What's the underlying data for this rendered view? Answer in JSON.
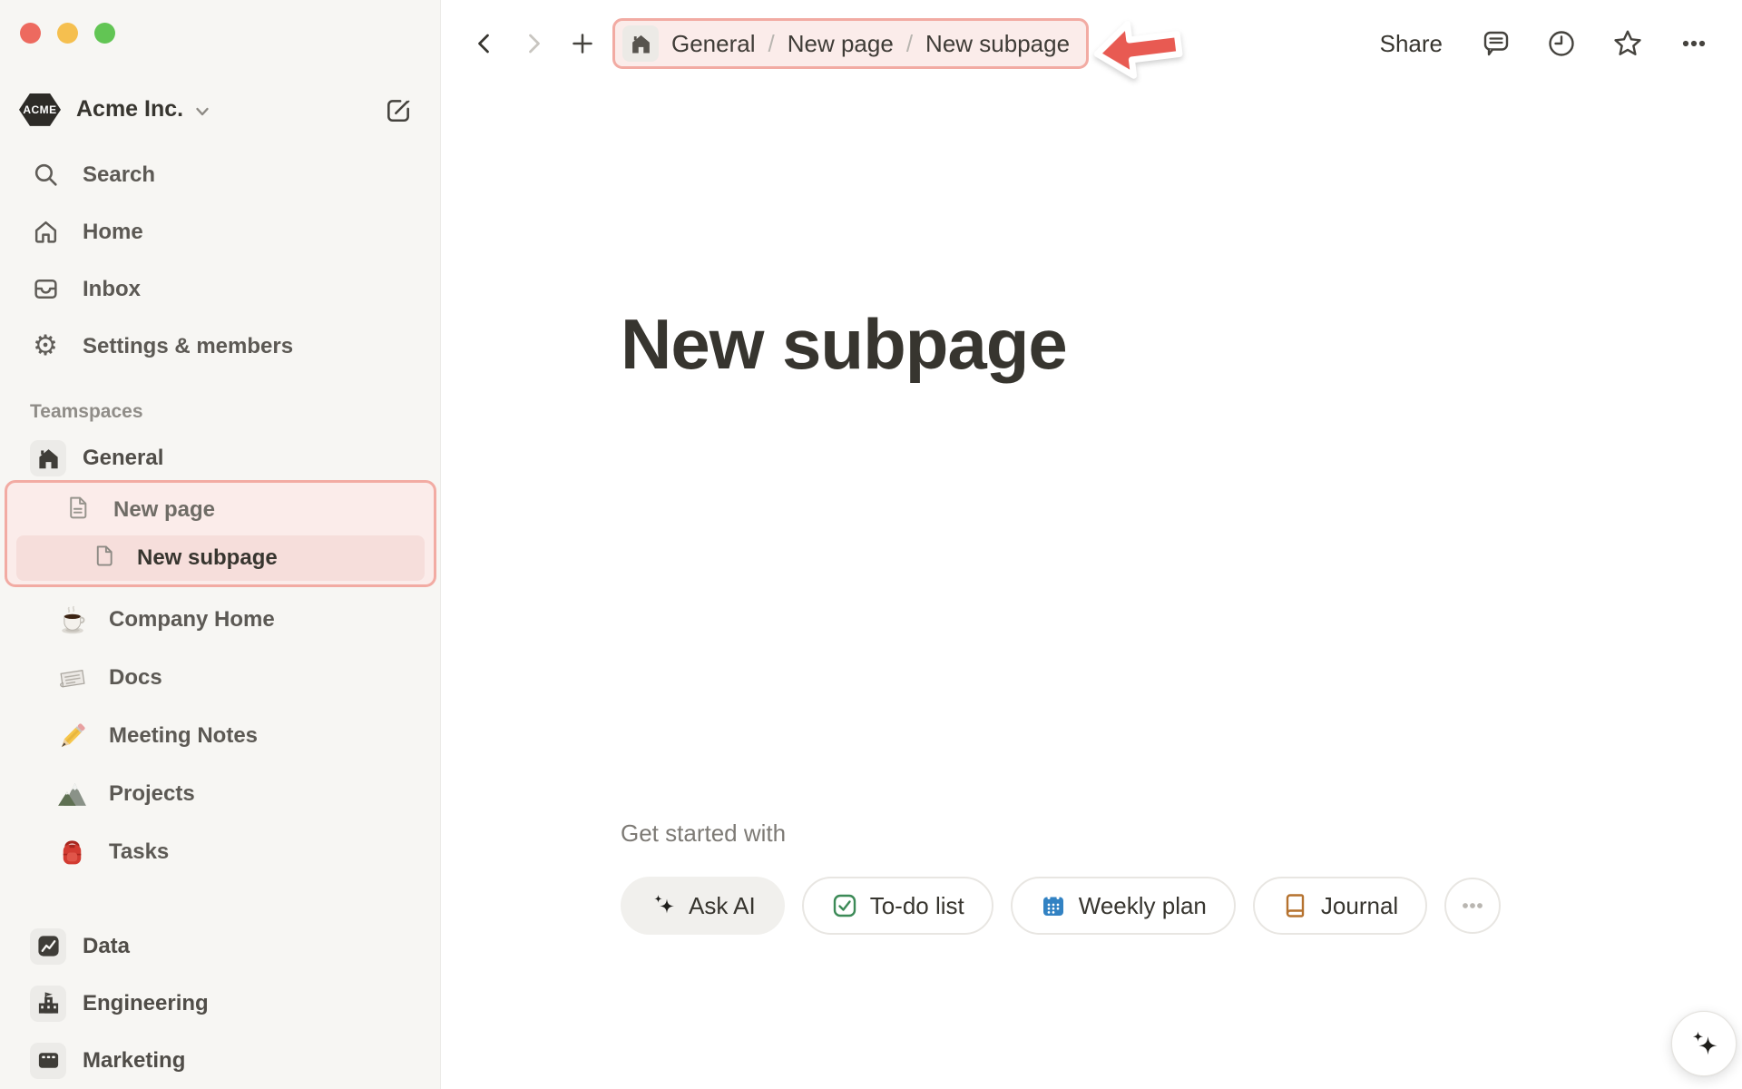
{
  "window": {
    "controls": [
      {
        "name": "close"
      },
      {
        "name": "minimize"
      },
      {
        "name": "zoom"
      }
    ]
  },
  "sidebar": {
    "workspace": {
      "name": "Acme Inc.",
      "logo": "ACME"
    },
    "nav": [
      {
        "icon": "search-icon",
        "label": "Search"
      },
      {
        "icon": "home-icon",
        "label": "Home"
      },
      {
        "icon": "inbox-icon",
        "label": "Inbox"
      },
      {
        "icon": "settings-icon",
        "label": "Settings & members"
      }
    ],
    "teamspaces_label": "Teamspaces",
    "general": {
      "icon": "house-badge-icon",
      "label": "General"
    },
    "general_pages": [
      {
        "icon": "page-lines-icon",
        "label": "New page"
      },
      {
        "icon": "page-blank-icon",
        "label": "New subpage",
        "selected": true
      }
    ],
    "general_items": [
      {
        "icon": "coffee-emoji-icon",
        "label": "Company Home"
      },
      {
        "icon": "newspaper-emoji-icon",
        "label": "Docs"
      },
      {
        "icon": "pencil-emoji-icon",
        "label": "Meeting Notes"
      },
      {
        "icon": "mountain-emoji-icon",
        "label": "Projects"
      },
      {
        "icon": "backpack-emoji-icon",
        "label": "Tasks"
      }
    ],
    "other_teamspaces": [
      {
        "icon": "chart-badge-icon",
        "label": "Data"
      },
      {
        "icon": "building-badge-icon",
        "label": "Engineering"
      },
      {
        "icon": "billboard-badge-icon",
        "label": "Marketing"
      }
    ]
  },
  "topbar": {
    "breadcrumb": {
      "items": [
        "General",
        "New page",
        "New subpage"
      ],
      "separator": "/"
    },
    "share_label": "Share"
  },
  "main": {
    "title": "New subpage",
    "get_started_label": "Get started with",
    "actions": [
      {
        "icon": "sparkles-icon",
        "label": "Ask AI"
      },
      {
        "icon": "todo-checkbox-icon",
        "label": "To-do list"
      },
      {
        "icon": "calendar-icon",
        "label": "Weekly plan"
      },
      {
        "icon": "journal-icon",
        "label": "Journal"
      }
    ]
  },
  "colors": {
    "sidebar-bg": "#f7f6f3",
    "text-dark": "#37352f",
    "accent-pink-border": "#f2aba3",
    "accent-pink-fill": "#fbecea",
    "accent-pink-selected": "#f6dedb",
    "arrow-red": "#e85a52",
    "todo-green": "#3c8a57",
    "calendar-blue": "#3282c3",
    "journal-orange": "#b5722f"
  }
}
